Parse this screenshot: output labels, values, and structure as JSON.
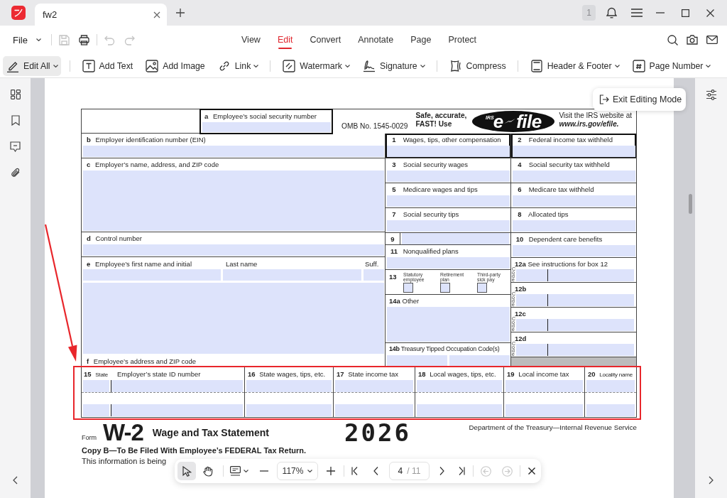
{
  "window": {
    "tab_title": "fw2",
    "notification_count": "1"
  },
  "menubar": {
    "file_label": "File",
    "quick_actions": [
      {
        "disabled": true
      },
      {
        "disabled": false
      },
      {
        "disabled": true
      },
      {
        "disabled": true
      }
    ],
    "tabs": [
      {
        "label": "View",
        "selected": false
      },
      {
        "label": "Edit",
        "selected": true
      },
      {
        "label": "Convert",
        "selected": false
      },
      {
        "label": "Annotate",
        "selected": false
      },
      {
        "label": "Page",
        "selected": false
      },
      {
        "label": "Protect",
        "selected": false
      }
    ]
  },
  "toolbar": {
    "groups": [
      {
        "items": [
          {
            "label": "Edit All",
            "dropdown": true,
            "selected": true
          }
        ]
      },
      {
        "items": [
          {
            "label": "Add Text",
            "dropdown": false,
            "selected": false
          },
          {
            "label": "Add Image",
            "dropdown": false,
            "selected": false
          },
          {
            "label": "Link",
            "dropdown": true,
            "selected": false
          }
        ]
      },
      {
        "items": [
          {
            "label": "Watermark",
            "dropdown": true,
            "selected": false
          },
          {
            "label": "Signature",
            "dropdown": true,
            "selected": false
          }
        ]
      },
      {
        "items": [
          {
            "label": "Compress",
            "dropdown": false,
            "selected": false
          }
        ]
      },
      {
        "items": [
          {
            "label": "Header & Footer",
            "dropdown": true,
            "selected": false
          },
          {
            "label": "Page Number",
            "dropdown": true,
            "selected": false
          }
        ]
      }
    ]
  },
  "exit_button": "Exit Editing Mode",
  "form": {
    "box_a": {
      "letter": "a",
      "label": "Employee’s social security number"
    },
    "omb": "OMB No. 1545-0029",
    "promo": {
      "lines": [
        "Safe, accurate,",
        "FAST! Use"
      ],
      "logo": {
        "mark": "IRS",
        "e": "e",
        "file": "file"
      },
      "visit": "Visit the IRS website at",
      "url": "www.irs.gov/efile."
    },
    "left_boxes": [
      {
        "kind": "single",
        "letter": "b",
        "label": "Employer identification number (EIN)"
      },
      {
        "kind": "tall",
        "letter": "c",
        "label": "Employer’s name, address, and ZIP code"
      },
      {
        "kind": "single",
        "letter": "d",
        "label": "Control number"
      },
      {
        "kind": "employee",
        "letter": "e",
        "labels": [
          "Employee’s first name and initial",
          "Last name",
          "Suff."
        ],
        "footer_letter": "f",
        "footer_label": "Employee’s address and ZIP code"
      }
    ],
    "middle_boxes": [
      {
        "kind": "amount",
        "number": "1",
        "label": "Wages, tips, other compensation",
        "emphasized": true
      },
      {
        "kind": "amount",
        "number": "3",
        "label": "Social security wages",
        "emphasized": false
      },
      {
        "kind": "amount",
        "number": "5",
        "label": "Medicare wages and tips",
        "emphasized": false
      },
      {
        "kind": "amount",
        "number": "7",
        "label": "Social security tips",
        "emphasized": false
      },
      {
        "kind": "inline",
        "number": "9"
      },
      {
        "kind": "amount",
        "number": "11",
        "label": "Nonqualified plans",
        "emphasized": false
      },
      {
        "kind": "checkboxes",
        "number": "13",
        "options": [
          {
            "label": "Statutory employee",
            "checked": false
          },
          {
            "label": "Retirement plan",
            "checked": false
          },
          {
            "label": "Third-party sick pay",
            "checked": false
          }
        ]
      },
      {
        "kind": "tall",
        "number": "14a",
        "label": "Other"
      },
      {
        "kind": "split",
        "number": "14b",
        "label": "Treasury Tipped Occupation Code(s)"
      }
    ],
    "right_boxes": [
      {
        "kind": "amount",
        "number": "2",
        "label": "Federal income tax withheld",
        "emphasized": true
      },
      {
        "kind": "amount",
        "number": "4",
        "label": "Social security tax withheld",
        "emphasized": false
      },
      {
        "kind": "amount",
        "number": "6",
        "label": "Medicare tax withheld",
        "emphasized": false
      },
      {
        "kind": "amount",
        "number": "8",
        "label": "Allocated tips",
        "emphasized": false
      },
      {
        "kind": "amount",
        "number": "10",
        "label": "Dependent care benefits",
        "emphasized": false
      },
      {
        "kind": "code",
        "number": "12a",
        "label": "See instructions for box 12",
        "code_label": "Code"
      },
      {
        "kind": "code",
        "number": "12b",
        "code_label": "Code"
      },
      {
        "kind": "code",
        "number": "12c",
        "code_label": "Code"
      },
      {
        "kind": "code",
        "number": "12d",
        "code_label": "Code"
      },
      {
        "kind": "shaded"
      }
    ],
    "state_columns": [
      {
        "number": "15",
        "label": "State"
      },
      {
        "label": "Employer’s state ID number"
      },
      {
        "number": "16",
        "label": "State wages, tips, etc."
      },
      {
        "number": "17",
        "label": "State income tax"
      },
      {
        "number": "18",
        "label": "Local wages, tips, etc."
      },
      {
        "number": "19",
        "label": "Local income tax"
      },
      {
        "number": "20",
        "label": "Locality name"
      }
    ],
    "footer": {
      "form_word": "Form",
      "form_number": "W-2",
      "title": "Wage and Tax Statement",
      "year": "2026",
      "department": "Department of the Treasury—Internal Revenue Service",
      "copy_line": "Copy B—To Be Filed With Employee’s FEDERAL Tax Return.",
      "info_line": "This information is being"
    }
  },
  "bottom_toolbar": {
    "tools": [
      {
        "selected": true
      },
      {
        "selected": false
      }
    ],
    "zoom": "117%",
    "page_input": "4",
    "page_total": "/ 11",
    "history": [
      {
        "disabled": true
      },
      {
        "disabled": true
      }
    ]
  }
}
